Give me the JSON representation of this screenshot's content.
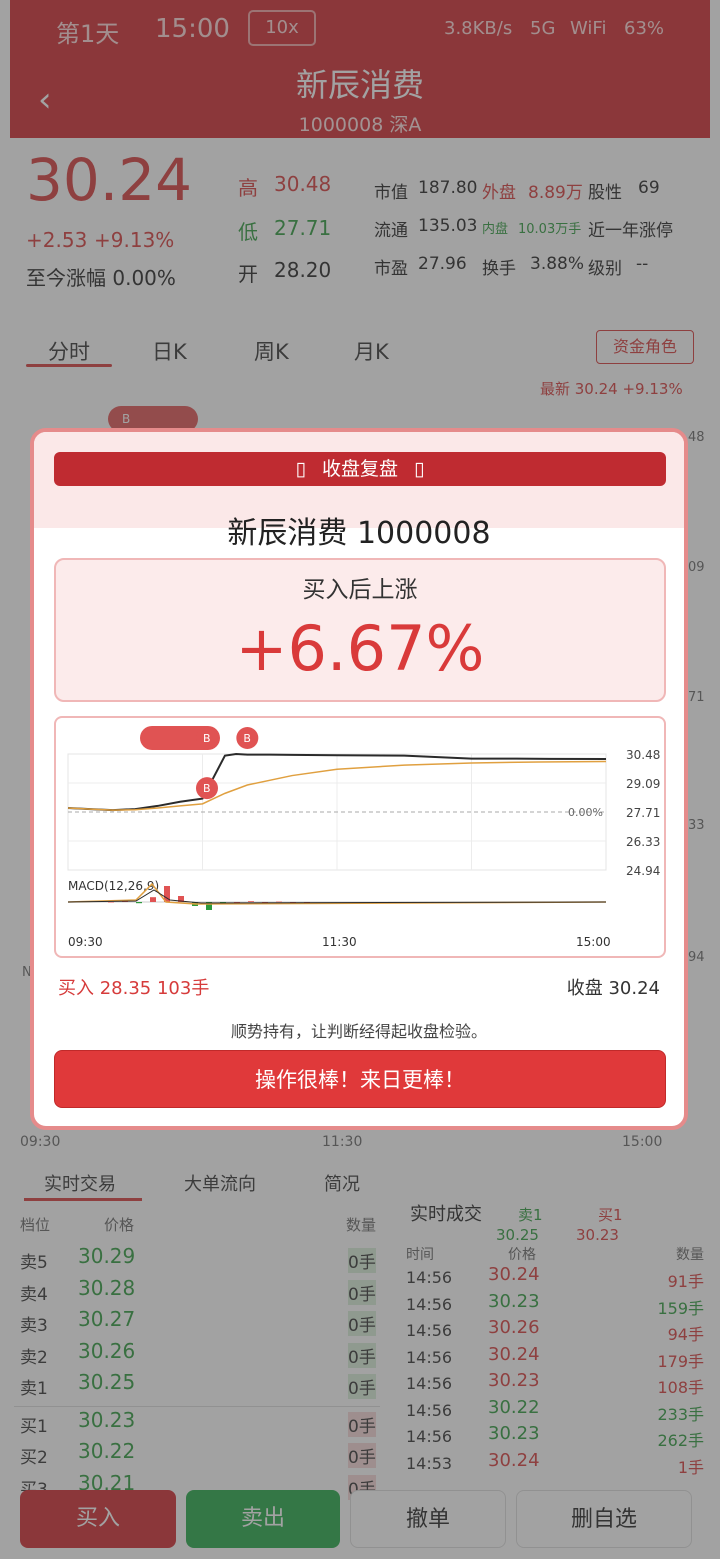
{
  "status_bar": {
    "day": "第1天",
    "time": "15:00",
    "speed": "10x",
    "net_speed": "3.8KB/s",
    "network": "5G",
    "wifi": "WiFi",
    "battery": "63%"
  },
  "header": {
    "back_icon": "chevron-left-icon",
    "title": "新辰消费",
    "code_market": "1000008  深A"
  },
  "quote": {
    "price": "30.24",
    "change": "+2.53",
    "change_pct": "+9.13%",
    "since_label": "至今涨幅 0.00%",
    "high_label": "高",
    "high": "30.48",
    "low_label": "低",
    "low": "27.71",
    "open_label": "开",
    "open": "28.20",
    "mcap_label": "市值",
    "mcap": "187.80",
    "outer_label": "外盘",
    "outer": "8.89万",
    "stock_type_label": "股性",
    "stock_type": "69",
    "float_label": "流通",
    "float": "135.03",
    "inner_label": "内盘",
    "inner": "10.03万手",
    "limit_label": "近一年涨停",
    "pe_label": "市盈",
    "pe": "27.96",
    "turnover_label": "换手",
    "turnover": "3.88%",
    "level_label": "级别",
    "level": "--"
  },
  "chart_tabs": {
    "items": [
      "分时",
      "日K",
      "周K",
      "月K"
    ],
    "fund_button": "资金角色",
    "latest": "最新 30.24 +9.13%"
  },
  "bg_chart": {
    "t_start": "09:30",
    "t_mid": "11:30",
    "t_end": "15:00",
    "r1": "48",
    "r2": "09",
    "r3": "71",
    "r4": "33",
    "r5": "94",
    "marker_b": "B",
    "vol_label": "N"
  },
  "dialog": {
    "banner": "收盘复盘",
    "stock": "新辰消费  1000008",
    "gain_label": "买入后上涨",
    "gain_value": "+6.67%",
    "buy_line": "买入 28.35  103手",
    "close_line": "收盘 30.24",
    "advice": "顺势持有，让判断经得起收盘检验。",
    "ok_button": "操作很棒！来日更棒！"
  },
  "chart_data": {
    "type": "line",
    "y_ticks": [
      "30.48",
      "29.09",
      "27.71",
      "26.33",
      "24.94"
    ],
    "x_ticks": [
      "09:30",
      "11:30",
      "15:00"
    ],
    "baseline_label": "0.00%",
    "macd_label": "MACD(12,26,9)",
    "markers": [
      "B",
      "B",
      "B"
    ],
    "ylim": [
      24.94,
      30.48
    ],
    "series": [
      {
        "x": [
          0,
          10,
          20,
          30,
          40,
          50,
          60,
          70,
          75,
          80,
          90,
          100,
          120,
          150,
          180,
          200,
          215,
          240
        ],
        "values": [
          27.9,
          27.85,
          27.8,
          27.85,
          28.0,
          28.2,
          28.35,
          30.4,
          30.48,
          30.45,
          30.45,
          30.44,
          30.42,
          30.4,
          30.26,
          30.26,
          30.25,
          30.24
        ]
      },
      {
        "x": [
          0,
          10,
          20,
          30,
          40,
          50,
          60,
          70,
          80,
          100,
          120,
          150,
          180,
          210,
          240
        ],
        "values": [
          27.9,
          27.85,
          27.8,
          27.82,
          27.9,
          28.0,
          28.1,
          28.6,
          29.0,
          29.45,
          29.75,
          29.95,
          30.05,
          30.1,
          30.12
        ]
      }
    ],
    "macd_hist": [
      0,
      0.02,
      -0.03,
      0.12,
      0.4,
      0.15,
      -0.1,
      -0.2,
      -0.05,
      0,
      0.02,
      0,
      0.01,
      0,
      0
    ]
  },
  "bottom_tabs": {
    "items": [
      "实时交易",
      "大单流向",
      "简况"
    ]
  },
  "order_book": {
    "head": {
      "level": "档位",
      "price": "价格",
      "qty": "数量"
    },
    "rows": [
      {
        "level": "卖5",
        "price": "30.29",
        "qty": "0手"
      },
      {
        "level": "卖4",
        "price": "30.28",
        "qty": "0手"
      },
      {
        "level": "卖3",
        "price": "30.27",
        "qty": "0手"
      },
      {
        "level": "卖2",
        "price": "30.26",
        "qty": "0手"
      },
      {
        "level": "卖1",
        "price": "30.25",
        "qty": "0手"
      },
      {
        "level": "买1",
        "price": "30.23",
        "qty": "0手"
      },
      {
        "level": "买2",
        "price": "30.22",
        "qty": "0手"
      },
      {
        "level": "买3",
        "price": "30.21",
        "qty": "0手"
      }
    ]
  },
  "trades": {
    "title": "实时成交",
    "sell1_label": "卖1",
    "sell1_price": "30.25",
    "buy1_label": "买1",
    "buy1_price": "30.23",
    "head": {
      "time": "时间",
      "price": "价格",
      "qty": "数量"
    },
    "rows": [
      {
        "time": "14:56",
        "price": "30.24",
        "qty": "91手",
        "dir": "r"
      },
      {
        "time": "14:56",
        "price": "30.23",
        "qty": "159手",
        "dir": "g"
      },
      {
        "time": "14:56",
        "price": "30.26",
        "qty": "94手",
        "dir": "r"
      },
      {
        "time": "14:56",
        "price": "30.24",
        "qty": "179手",
        "dir": "r"
      },
      {
        "time": "14:56",
        "price": "30.23",
        "qty": "108手",
        "dir": "r"
      },
      {
        "time": "14:56",
        "price": "30.22",
        "qty": "233手",
        "dir": "g"
      },
      {
        "time": "14:56",
        "price": "30.23",
        "qty": "262手",
        "dir": "g"
      },
      {
        "time": "14:53",
        "price": "30.24",
        "qty": "1手",
        "dir": "r"
      }
    ]
  },
  "bottom_buttons": {
    "buy": "买入",
    "sell": "卖出",
    "cancel": "撤单",
    "remove": "删自选"
  }
}
